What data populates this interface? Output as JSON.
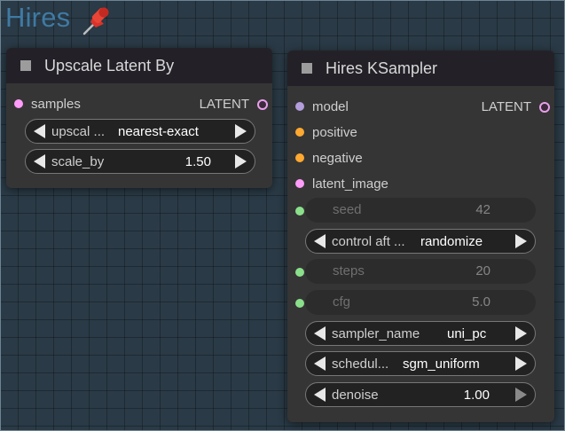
{
  "group": {
    "title": "Hires"
  },
  "upscale_node": {
    "title": "Upscale Latent By",
    "input": "samples",
    "output": "LATENT",
    "widgets": [
      {
        "label": "upscal ...",
        "value": "nearest-exact"
      },
      {
        "label": "scale_by",
        "value": "1.50"
      }
    ]
  },
  "ksampler_node": {
    "title": "Hires KSampler",
    "output": "LATENT",
    "inputs": [
      {
        "label": "model",
        "color": "#b39ddb"
      },
      {
        "label": "positive",
        "color": "#ffa931"
      },
      {
        "label": "negative",
        "color": "#ffa931"
      },
      {
        "label": "latent_image",
        "color": "#ff9cf9"
      }
    ],
    "converted": {
      "seed": {
        "label": "seed",
        "value": "42"
      },
      "steps": {
        "label": "steps",
        "value": "20"
      },
      "cfg": {
        "label": "cfg",
        "value": "5.0"
      }
    },
    "widgets": {
      "control": {
        "label": "control aft ...",
        "value": "randomize"
      },
      "sampler": {
        "label": "sampler_name",
        "value": "uni_pc"
      },
      "scheduler": {
        "label": "schedul...",
        "value": "sgm_uniform"
      },
      "denoise": {
        "label": "denoise",
        "value": "1.00"
      }
    }
  }
}
